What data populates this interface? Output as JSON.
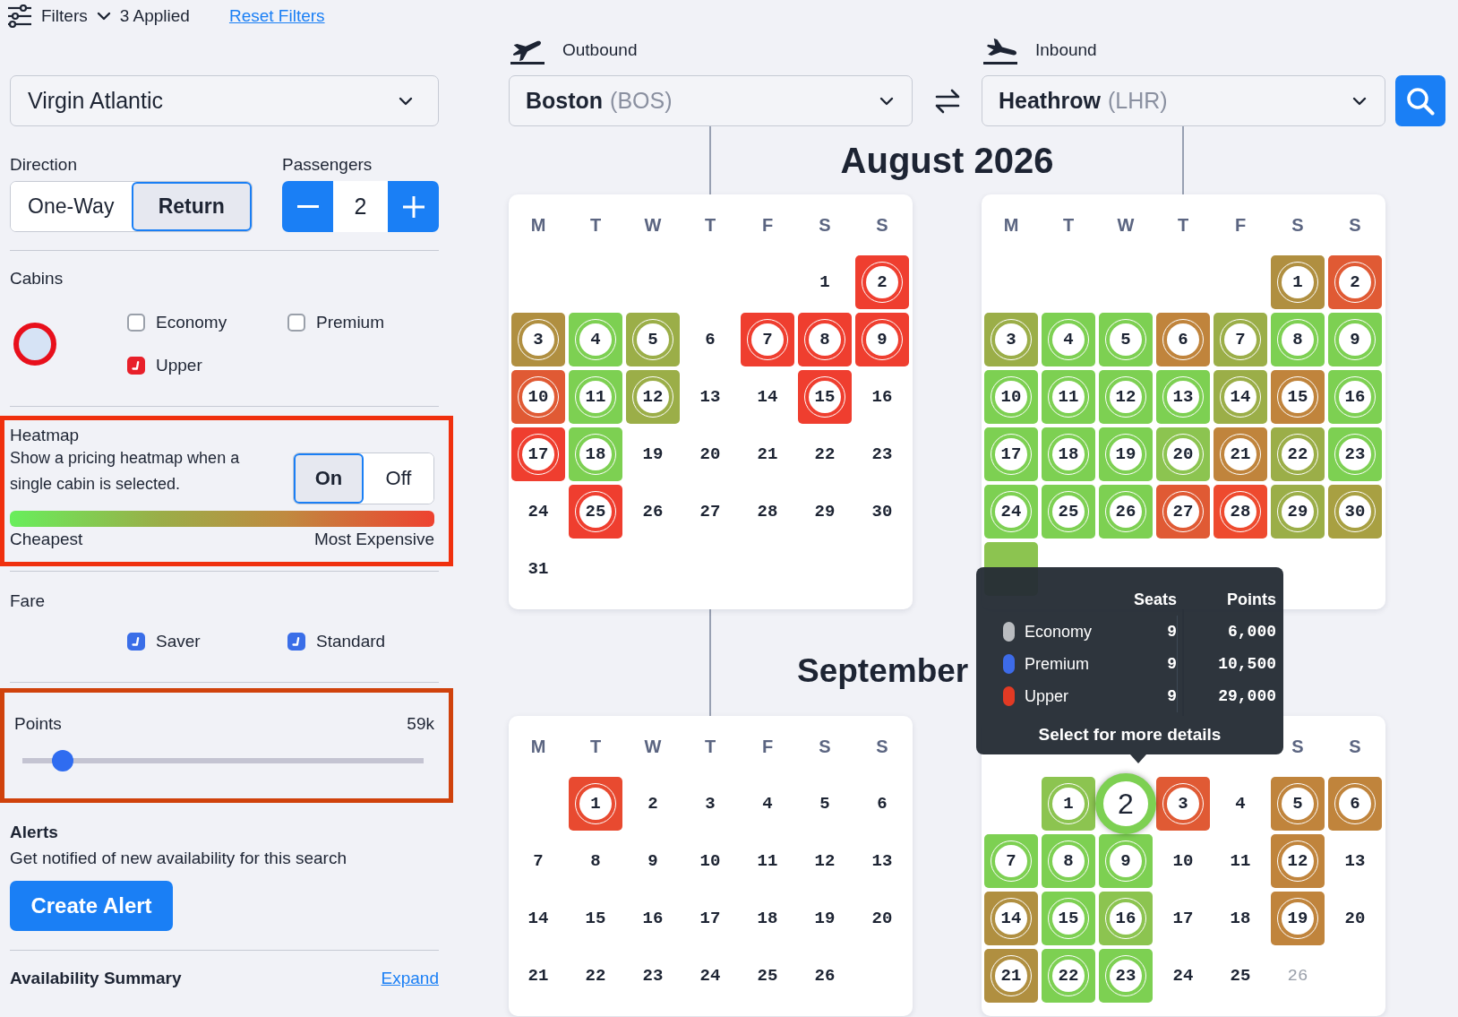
{
  "filter_bar": {
    "label": "Filters",
    "applied": "3 Applied",
    "reset_link": "Reset Filters"
  },
  "airline": {
    "value": "Virgin Atlantic"
  },
  "direction": {
    "label": "Direction",
    "options": [
      {
        "label": "One-Way",
        "selected": false
      },
      {
        "label": "Return",
        "selected": true
      }
    ]
  },
  "passengers": {
    "label": "Passengers",
    "value": "2"
  },
  "cabins": {
    "label": "Cabins",
    "options": [
      {
        "label": "Economy",
        "checked": false
      },
      {
        "label": "Premium",
        "checked": false
      },
      {
        "label": "Upper",
        "checked": true
      }
    ]
  },
  "heatmap": {
    "highlighted": true,
    "title": "Heatmap",
    "description": "Show a pricing heatmap when a single cabin is selected.",
    "toggle": [
      {
        "label": "On",
        "selected": true
      },
      {
        "label": "Off",
        "selected": false
      }
    ],
    "low_label": "Cheapest",
    "high_label": "Most Expensive"
  },
  "fare": {
    "label": "Fare",
    "options": [
      {
        "label": "Saver",
        "checked": true
      },
      {
        "label": "Standard",
        "checked": true
      }
    ]
  },
  "points": {
    "highlighted": true,
    "label": "Points",
    "value": "59k",
    "level": 0.1
  },
  "alerts": {
    "title": "Alerts",
    "description": "Get notified of new availability for this search",
    "button": "Create Alert"
  },
  "summary": {
    "title": "Availability Summary",
    "link": "Expand"
  },
  "outbound": {
    "label": "Outbound",
    "city": "Boston",
    "code": "(BOS)"
  },
  "inbound": {
    "label": "Inbound",
    "city": "Heathrow",
    "code": "(LHR)"
  },
  "months": [
    {
      "title": "August 2026",
      "outbound": {
        "weekdays": [
          "M",
          "T",
          "W",
          "T",
          "F",
          "S",
          "S"
        ],
        "weeks": [
          [
            {
              "label": "1",
              "kind": "plain"
            },
            {
              "label": "2",
              "kind": "priced",
              "color": "#ef3e2f"
            }
          ],
          [
            {
              "label": "3",
              "kind": "priced",
              "color": "#b08f40"
            },
            {
              "label": "4",
              "kind": "priced",
              "color": "#7dd052"
            },
            {
              "label": "5",
              "kind": "priced",
              "color": "#9bae48"
            },
            {
              "label": "6",
              "kind": "plain"
            },
            {
              "label": "7",
              "kind": "priced",
              "color": "#ef3e2f"
            },
            {
              "label": "8",
              "kind": "priced",
              "color": "#ef3e2f"
            },
            {
              "label": "9",
              "kind": "priced",
              "color": "#ef3e2f"
            }
          ],
          [
            {
              "label": "10",
              "kind": "priced",
              "color": "#e05a34"
            },
            {
              "label": "11",
              "kind": "priced",
              "color": "#7dd052"
            },
            {
              "label": "12",
              "kind": "priced",
              "color": "#9bae48"
            },
            {
              "label": "13",
              "kind": "plain"
            },
            {
              "label": "14",
              "kind": "plain"
            },
            {
              "label": "15",
              "kind": "priced",
              "color": "#ef3e2f"
            },
            {
              "label": "16",
              "kind": "plain"
            }
          ],
          [
            {
              "label": "17",
              "kind": "priced",
              "color": "#ef3e2f"
            },
            {
              "label": "18",
              "kind": "priced",
              "color": "#7dd052"
            },
            {
              "label": "19",
              "kind": "plain"
            },
            {
              "label": "20",
              "kind": "plain"
            },
            {
              "label": "21",
              "kind": "plain"
            },
            {
              "label": "22",
              "kind": "plain"
            },
            {
              "label": "23",
              "kind": "plain"
            }
          ],
          [
            {
              "label": "24",
              "kind": "plain"
            },
            {
              "label": "25",
              "kind": "priced",
              "color": "#ef3e2f"
            },
            {
              "label": "26",
              "kind": "plain"
            },
            {
              "label": "27",
              "kind": "plain"
            },
            {
              "label": "28",
              "kind": "plain"
            },
            {
              "label": "29",
              "kind": "plain"
            },
            {
              "label": "30",
              "kind": "plain"
            }
          ],
          [
            {
              "label": "31",
              "kind": "plain"
            }
          ]
        ]
      },
      "inbound": {
        "weekdays": [
          "M",
          "T",
          "W",
          "T",
          "F",
          "S",
          "S"
        ],
        "weeks": [
          [
            {
              "label": "1",
              "kind": "priced",
              "color": "#b08f40"
            },
            {
              "label": "2",
              "kind": "priced",
              "color": "#e05a34"
            }
          ],
          [
            {
              "label": "3",
              "kind": "priced",
              "color": "#9bae48"
            },
            {
              "label": "4",
              "kind": "priced",
              "color": "#7dd052"
            },
            {
              "label": "5",
              "kind": "priced",
              "color": "#7dd052"
            },
            {
              "label": "6",
              "kind": "priced",
              "color": "#c0843c"
            },
            {
              "label": "7",
              "kind": "priced",
              "color": "#9bae48"
            },
            {
              "label": "8",
              "kind": "priced",
              "color": "#7dd052"
            },
            {
              "label": "9",
              "kind": "priced",
              "color": "#7dd052"
            }
          ],
          [
            {
              "label": "10",
              "kind": "priced",
              "color": "#7dd052"
            },
            {
              "label": "11",
              "kind": "priced",
              "color": "#7dd052"
            },
            {
              "label": "12",
              "kind": "priced",
              "color": "#7dd052"
            },
            {
              "label": "13",
              "kind": "priced",
              "color": "#7dd052"
            },
            {
              "label": "14",
              "kind": "priced",
              "color": "#9bae48"
            },
            {
              "label": "15",
              "kind": "priced",
              "color": "#c0843c"
            },
            {
              "label": "16",
              "kind": "priced",
              "color": "#7dd052"
            }
          ],
          [
            {
              "label": "17",
              "kind": "priced",
              "color": "#7dd052"
            },
            {
              "label": "18",
              "kind": "priced",
              "color": "#7dd052"
            },
            {
              "label": "19",
              "kind": "priced",
              "color": "#7dd052"
            },
            {
              "label": "20",
              "kind": "priced",
              "color": "#8cc450"
            },
            {
              "label": "21",
              "kind": "priced",
              "color": "#c0843c"
            },
            {
              "label": "22",
              "kind": "priced",
              "color": "#9bae48"
            },
            {
              "label": "23",
              "kind": "priced",
              "color": "#7dd052"
            }
          ],
          [
            {
              "label": "24",
              "kind": "priced",
              "color": "#7dd052"
            },
            {
              "label": "25",
              "kind": "priced",
              "color": "#7dd052"
            },
            {
              "label": "26",
              "kind": "priced",
              "color": "#7dd052"
            },
            {
              "label": "27",
              "kind": "priced",
              "color": "#e05a34"
            },
            {
              "label": "28",
              "kind": "priced",
              "color": "#ee4a2e"
            },
            {
              "label": "29",
              "kind": "priced",
              "color": "#9bae48"
            },
            {
              "label": "30",
              "kind": "priced",
              "color": "#a8a042"
            }
          ],
          [
            {
              "kind": "covered",
              "color": "#8cc450"
            }
          ]
        ]
      }
    },
    {
      "title": "September",
      "outbound": {
        "weekdays": [
          "M",
          "T",
          "W",
          "T",
          "F",
          "S",
          "S"
        ],
        "weeks": [
          [
            {
              "label": "1",
              "kind": "priced",
              "color": "#e84a30"
            },
            {
              "label": "2",
              "kind": "plain"
            },
            {
              "label": "3",
              "kind": "plain"
            },
            {
              "label": "4",
              "kind": "plain"
            },
            {
              "label": "5",
              "kind": "plain"
            },
            {
              "label": "6",
              "kind": "plain"
            }
          ],
          [
            {
              "label": "7",
              "kind": "plain"
            },
            {
              "label": "8",
              "kind": "plain"
            },
            {
              "label": "9",
              "kind": "plain"
            },
            {
              "label": "10",
              "kind": "plain"
            },
            {
              "label": "11",
              "kind": "plain"
            },
            {
              "label": "12",
              "kind": "plain"
            },
            {
              "label": "13",
              "kind": "plain"
            }
          ],
          [
            {
              "label": "14",
              "kind": "plain"
            },
            {
              "label": "15",
              "kind": "plain"
            },
            {
              "label": "16",
              "kind": "plain"
            },
            {
              "label": "17",
              "kind": "plain"
            },
            {
              "label": "18",
              "kind": "plain"
            },
            {
              "label": "19",
              "kind": "plain"
            },
            {
              "label": "20",
              "kind": "plain"
            }
          ],
          [
            {
              "label": "21",
              "kind": "plain"
            },
            {
              "label": "22",
              "kind": "plain"
            },
            {
              "label": "23",
              "kind": "plain"
            },
            {
              "label": "24",
              "kind": "plain"
            },
            {
              "label": "25",
              "kind": "plain"
            },
            {
              "label": "26",
              "kind": "plain"
            }
          ]
        ]
      },
      "inbound": {
        "weekdays": [
          "S",
          "S"
        ],
        "weeks": [
          [
            {
              "label": "1",
              "kind": "priced",
              "color": "#8cc450"
            },
            {
              "label": "2",
              "kind": "hover",
              "color": "#7dd052"
            },
            {
              "label": "3",
              "kind": "priced",
              "color": "#e05a34"
            },
            {
              "label": "4",
              "kind": "plain"
            },
            {
              "label": "5",
              "kind": "priced",
              "color": "#c0843c"
            },
            {
              "label": "6",
              "kind": "priced",
              "color": "#c0843c"
            }
          ],
          [
            {
              "label": "7",
              "kind": "priced",
              "color": "#7dd052"
            },
            {
              "label": "8",
              "kind": "priced",
              "color": "#7dd052"
            },
            {
              "label": "9",
              "kind": "priced",
              "color": "#7dd052"
            },
            {
              "label": "10",
              "kind": "plain"
            },
            {
              "label": "11",
              "kind": "plain"
            },
            {
              "label": "12",
              "kind": "priced",
              "color": "#c0843c"
            },
            {
              "label": "13",
              "kind": "plain"
            }
          ],
          [
            {
              "label": "14",
              "kind": "priced",
              "color": "#b08f40"
            },
            {
              "label": "15",
              "kind": "priced",
              "color": "#7dd052"
            },
            {
              "label": "16",
              "kind": "priced",
              "color": "#8cc450"
            },
            {
              "label": "17",
              "kind": "plain"
            },
            {
              "label": "18",
              "kind": "plain"
            },
            {
              "label": "19",
              "kind": "priced",
              "color": "#c0843c"
            },
            {
              "label": "20",
              "kind": "plain"
            }
          ],
          [
            {
              "label": "21",
              "kind": "priced",
              "color": "#b08f40"
            },
            {
              "label": "22",
              "kind": "priced",
              "color": "#7dd052"
            },
            {
              "label": "23",
              "kind": "priced",
              "color": "#7dd052"
            },
            {
              "label": "24",
              "kind": "plain"
            },
            {
              "label": "25",
              "kind": "plain"
            },
            {
              "label": "26",
              "kind": "disabled"
            }
          ]
        ]
      }
    }
  ],
  "tooltip": {
    "columns": [
      "Seats",
      "Points"
    ],
    "rows": [
      {
        "cabin": "Economy",
        "color": "#b9bcc0",
        "seats": "9",
        "points": "6,000"
      },
      {
        "cabin": "Premium",
        "color": "#3d6be8",
        "seats": "9",
        "points": "10,500"
      },
      {
        "cabin": "Upper",
        "color": "#e23a24",
        "seats": "9",
        "points": "29,000"
      }
    ],
    "footer": "Select for more details"
  }
}
